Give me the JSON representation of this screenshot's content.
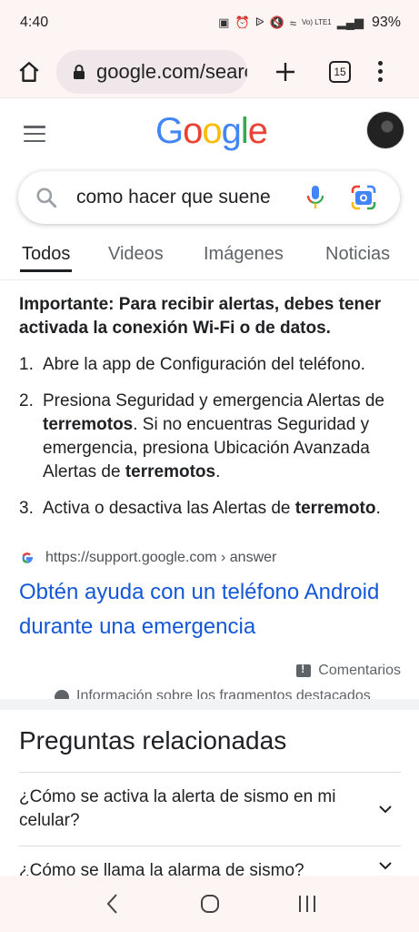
{
  "status_bar": {
    "time": "4:40",
    "signal_label": "Vo) LTE1",
    "battery": "93%"
  },
  "browser": {
    "url": "google.com/search",
    "tab_count": "15"
  },
  "google": {
    "logo_letters": [
      "G",
      "o",
      "o",
      "g",
      "l",
      "e"
    ],
    "logo_colors": [
      "#4285F4",
      "#EA4335",
      "#FBBC05",
      "#4285F4",
      "#34A853",
      "#EA4335"
    ]
  },
  "search": {
    "query": "como hacer que suene"
  },
  "tabs": [
    "Todos",
    "Videos",
    "Imágenes",
    "Noticias"
  ],
  "snippet": {
    "intro": "Importante: Para recibir alertas, debes tener activada la conexión Wi-Fi o de datos.",
    "steps": [
      {
        "num": "1.",
        "parts": [
          {
            "t": "Abre la app de Configuración del teléfono.",
            "b": false
          }
        ]
      },
      {
        "num": "2.",
        "parts": [
          {
            "t": "Presiona Seguridad y emergencia Alertas de ",
            "b": false
          },
          {
            "t": "terremotos",
            "b": true
          },
          {
            "t": ". Si no encuentras Seguridad y emergencia, presiona Ubicación Avanzada Alertas de ",
            "b": false
          },
          {
            "t": "terremotos",
            "b": true
          },
          {
            "t": ".",
            "b": false
          }
        ]
      },
      {
        "num": "3.",
        "parts": [
          {
            "t": "Activa o desactiva las Alertas de ",
            "b": false
          },
          {
            "t": "terremoto",
            "b": true
          },
          {
            "t": ".",
            "b": false
          }
        ]
      }
    ],
    "source_url": "https://support.google.com › answer",
    "result_title": "Obtén ayuda con un teléfono Android durante una emergencia",
    "feedback": "Comentarios",
    "about": "Información sobre los fragmentos destacados"
  },
  "related": {
    "title": "Preguntas relacionadas",
    "questions": [
      "¿Cómo se activa la alerta de sismo en mi celular?",
      "¿Cómo se llama la alarma de sismo?"
    ]
  },
  "colors": {
    "link": "#1558d6",
    "text": "#202124",
    "secondary": "#5f6368"
  }
}
